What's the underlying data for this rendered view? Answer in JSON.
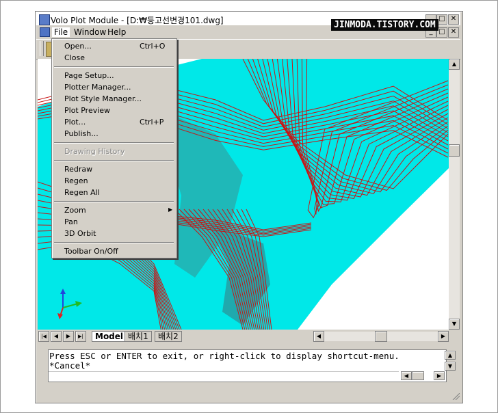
{
  "window": {
    "title": "Volo Plot Module - [D:₩등고선변경101.dwg]",
    "minimize_glyph": "_",
    "maximize_glyph": "□",
    "close_glyph": "✕"
  },
  "watermark": "JINMODA.TISTORY.COM",
  "menubar": {
    "items": [
      {
        "label": "File",
        "active": true
      },
      {
        "label": "Window"
      },
      {
        "label": "Help"
      }
    ]
  },
  "file_menu": {
    "items": [
      {
        "label": "Open...",
        "shortcut": "Ctrl+O"
      },
      {
        "label": "Close"
      },
      {
        "label": "Page Setup..."
      },
      {
        "label": "Plotter Manager..."
      },
      {
        "label": "Plot Style Manager..."
      },
      {
        "label": "Plot Preview"
      },
      {
        "label": "Plot...",
        "shortcut": "Ctrl+P"
      },
      {
        "label": "Publish..."
      },
      {
        "label": "Drawing History",
        "disabled": true
      },
      {
        "label": "Redraw"
      },
      {
        "label": "Regen"
      },
      {
        "label": "Regen All"
      },
      {
        "label": "Zoom",
        "submenu": true
      },
      {
        "label": "Pan"
      },
      {
        "label": "3D Orbit"
      },
      {
        "label": "Toolbar On/Off"
      }
    ]
  },
  "layout_tabs": {
    "nav_glyphs": [
      "|◀",
      "◀",
      "▶",
      "▶|"
    ],
    "tabs": [
      {
        "label": "Model",
        "active": true
      },
      {
        "label": "배치1"
      },
      {
        "label": "배치2"
      }
    ]
  },
  "command_line": {
    "lines": [
      "Press ESC or ENTER to exit, or right-click to display shortcut-menu.",
      "*Cancel*"
    ]
  },
  "colors": {
    "surface": "#00e8e8",
    "contour": "#c81414",
    "chrome": "#d4d0c8"
  }
}
